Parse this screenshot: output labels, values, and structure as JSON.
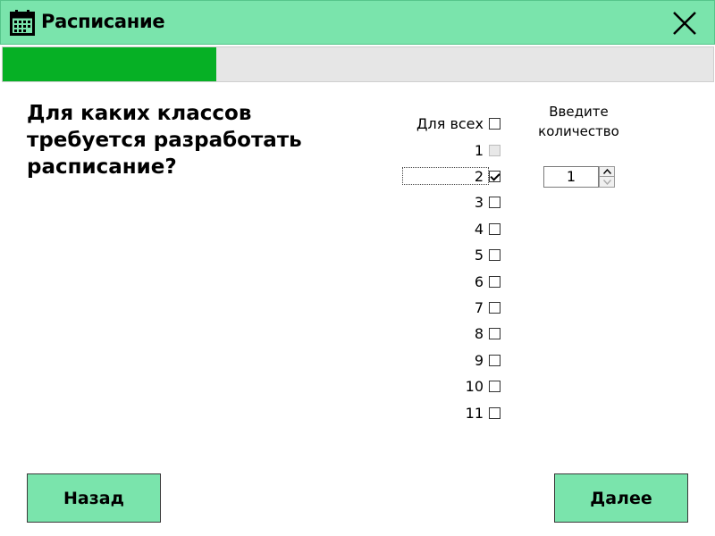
{
  "window": {
    "title": "Расписание",
    "icon": "calendar-icon",
    "close_icon": "close-icon"
  },
  "progress": {
    "value": 0.3
  },
  "question": "Для каких классов требуется разработать расписание?",
  "classes": {
    "all_label": "Для всех",
    "items": [
      {
        "label": "1",
        "checked": false,
        "disabled": true
      },
      {
        "label": "2",
        "checked": true,
        "disabled": false,
        "focused": true
      },
      {
        "label": "3",
        "checked": false,
        "disabled": false
      },
      {
        "label": "4",
        "checked": false,
        "disabled": false
      },
      {
        "label": "5",
        "checked": false,
        "disabled": false
      },
      {
        "label": "6",
        "checked": false,
        "disabled": false
      },
      {
        "label": "7",
        "checked": false,
        "disabled": false
      },
      {
        "label": "8",
        "checked": false,
        "disabled": false
      },
      {
        "label": "9",
        "checked": false,
        "disabled": false
      },
      {
        "label": "10",
        "checked": false,
        "disabled": false
      },
      {
        "label": "11",
        "checked": false,
        "disabled": false
      }
    ]
  },
  "quantity": {
    "label_line1": "Введите",
    "label_line2": "количество",
    "value": "1"
  },
  "buttons": {
    "back": "Назад",
    "next": "Далее"
  },
  "colors": {
    "accent": "#7ae4ac",
    "progress": "#06b025"
  }
}
